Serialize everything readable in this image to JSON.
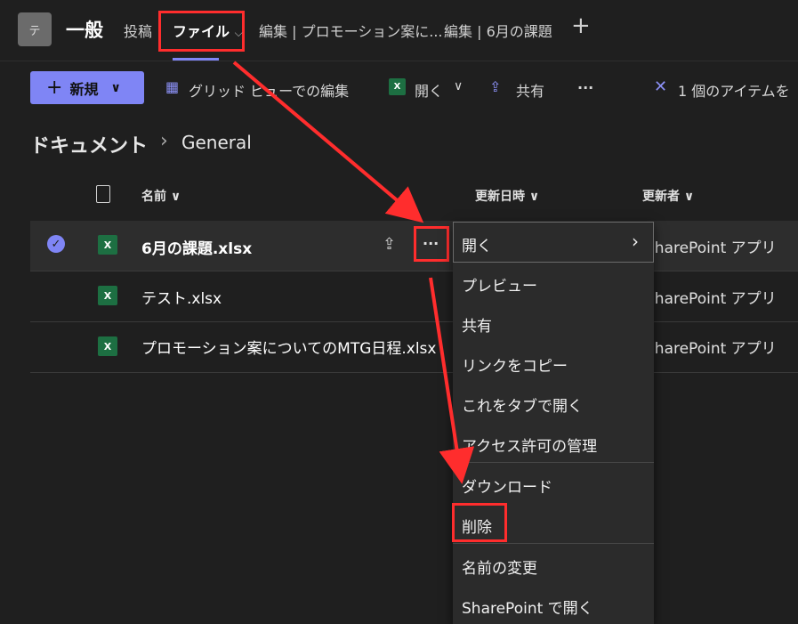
{
  "header": {
    "avatar_letter": "テ",
    "channel": "一般",
    "tabs": [
      "投稿",
      "ファイル",
      "編集 | プロモーション案に...",
      "編集 | 6月の課題"
    ],
    "add_tab": "+"
  },
  "toolbar": {
    "new_label": "新規",
    "grid_edit": "グリッド ビューでの編集",
    "open": "開く",
    "share": "共有",
    "more": "···",
    "selection": "1 個のアイテムを"
  },
  "breadcrumb": {
    "root": "ドキュメント",
    "current": "General"
  },
  "columns": {
    "name": "名前",
    "modified": "更新日時",
    "modified_by": "更新者"
  },
  "files": [
    {
      "name": "6月の課題.xlsx",
      "modified_by": "SharePoint アプリ",
      "selected": true
    },
    {
      "name": "テスト.xlsx",
      "modified_by": "SharePoint アプリ",
      "selected": false
    },
    {
      "name": "プロモーション案についてのMTG日程.xlsx",
      "modified_by": "SharePoint アプリ",
      "selected": false
    }
  ],
  "context_menu": [
    "開く",
    "プレビュー",
    "共有",
    "リンクをコピー",
    "これをタブで開く",
    "アクセス許可の管理",
    "ダウンロード",
    "削除",
    "名前の変更",
    "SharePoint で開く"
  ],
  "colors": {
    "accent": "#7f85f5",
    "highlight": "#ff2d2d",
    "excel": "#1d6f42"
  }
}
